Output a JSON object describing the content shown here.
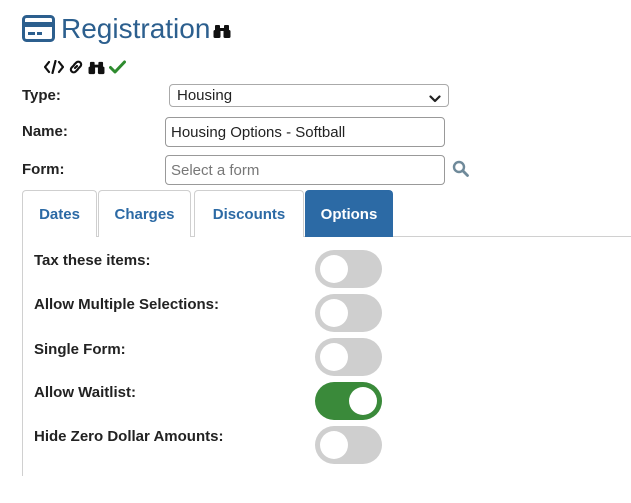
{
  "header": {
    "title": "Registration",
    "icons": [
      "credit-card-icon",
      "binoculars-icon"
    ],
    "toolbar_icons": [
      "code-icon",
      "link-icon",
      "binoculars-icon",
      "checkmark-icon"
    ]
  },
  "form": {
    "type_label": "Type:",
    "type_value": "Housing",
    "name_label": "Name:",
    "name_value": "Housing Options - Softball",
    "form_label": "Form:",
    "form_placeholder": "Select a form"
  },
  "tabs": [
    {
      "label": "Dates",
      "active": false
    },
    {
      "label": "Charges",
      "active": false
    },
    {
      "label": "Discounts",
      "active": false
    },
    {
      "label": "Options",
      "active": true
    }
  ],
  "options": [
    {
      "label": "Tax these items:",
      "on": false
    },
    {
      "label": "Allow Multiple Selections:",
      "on": false
    },
    {
      "label": "Single Form:",
      "on": false
    },
    {
      "label": "Allow Waitlist:",
      "on": true
    },
    {
      "label": "Hide Zero Dollar Amounts:",
      "on": false
    }
  ],
  "colors": {
    "accent": "#2c6aa5",
    "title": "#2c5f8e",
    "toggle_on": "#3a8a3a",
    "toggle_off": "#cfcfcf",
    "check": "#2e8b2e"
  }
}
